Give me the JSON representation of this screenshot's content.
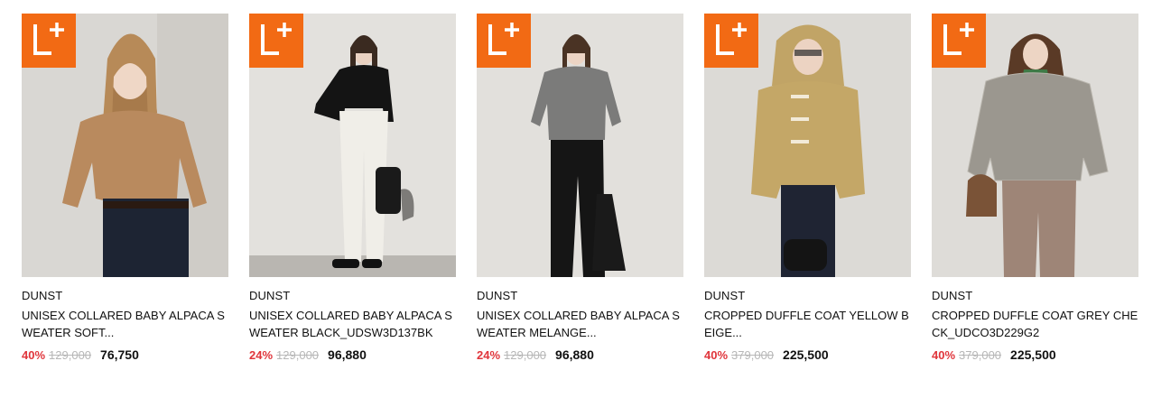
{
  "badge_text": "L+",
  "colors": {
    "badge": "#f26a14",
    "discount": "#e0353b",
    "original_price": "#b7b7b7"
  },
  "products": [
    {
      "brand": "DUNST",
      "title": "UNISEX COLLARED BABY ALPACA SWEATER SOFT...",
      "discount": "40%",
      "original_price": "129,000",
      "sale_price": "76,750"
    },
    {
      "brand": "DUNST",
      "title": "UNISEX COLLARED BABY ALPACA SWEATER BLACK_UDSW3D137BK",
      "discount": "24%",
      "original_price": "129,000",
      "sale_price": "96,880"
    },
    {
      "brand": "DUNST",
      "title": "UNISEX COLLARED BABY ALPACA SWEATER MELANGE...",
      "discount": "24%",
      "original_price": "129,000",
      "sale_price": "96,880"
    },
    {
      "brand": "DUNST",
      "title": "CROPPED DUFFLE COAT YELLOW BEIGE...",
      "discount": "40%",
      "original_price": "379,000",
      "sale_price": "225,500"
    },
    {
      "brand": "DUNST",
      "title": "CROPPED DUFFLE COAT GREY CHECK_UDCO3D229G2",
      "discount": "40%",
      "original_price": "379,000",
      "sale_price": "225,500"
    }
  ]
}
